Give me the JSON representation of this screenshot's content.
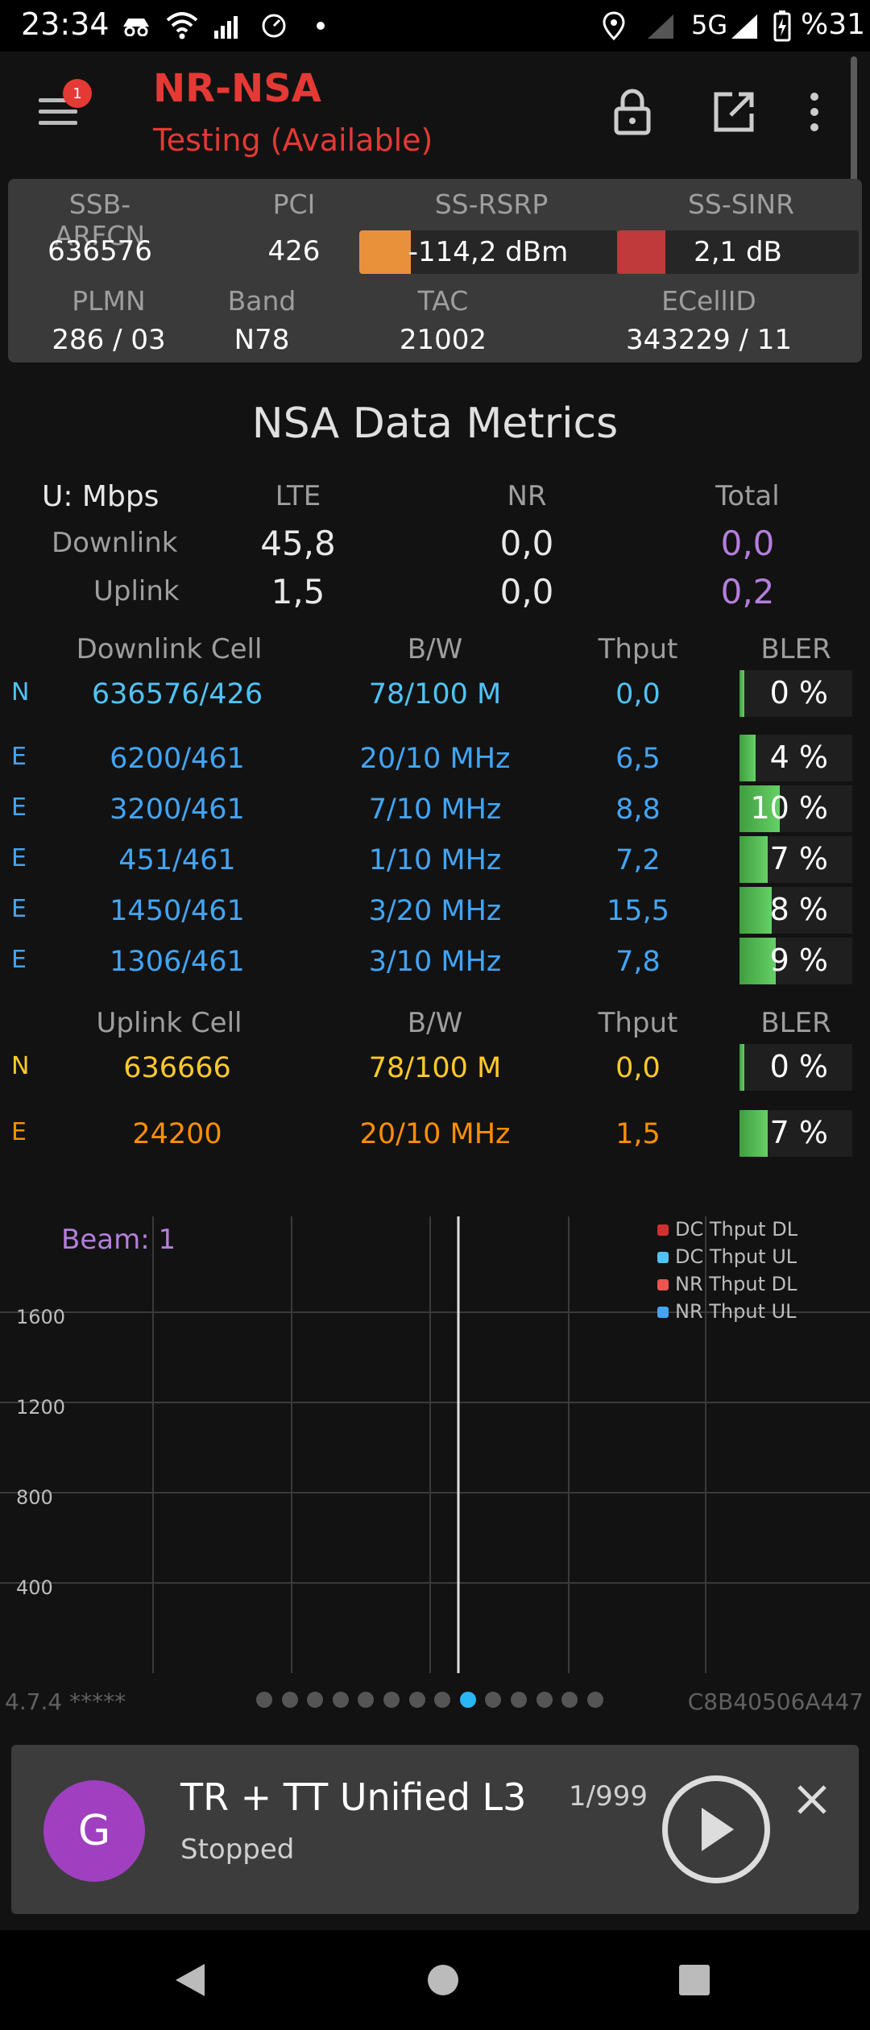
{
  "status_bar": {
    "time": "23:34",
    "network_type": "5G",
    "battery": "%31",
    "icons": [
      "incognito-icon",
      "wifi-icon",
      "signal-icon",
      "speedometer-icon",
      "dot-icon",
      "location-icon",
      "signal-icon",
      "battery-charging-icon"
    ]
  },
  "app_bar": {
    "title": "NR-NSA",
    "subtitle": "Testing (Available)",
    "notification_count": "1",
    "title_color": "#e53935"
  },
  "cell_info": {
    "labels": {
      "ssb_arfcn": "SSB-ARFCN",
      "pci": "PCI",
      "ss_rsrp": "SS-RSRP",
      "ss_sinr": "SS-SINR",
      "plmn": "PLMN",
      "band": "Band",
      "tac": "TAC",
      "ecellid": "ECellID"
    },
    "values": {
      "ssb_arfcn": "636576",
      "pci": "426",
      "ss_rsrp": "-114,2 dBm",
      "ss_sinr": "2,1 dB",
      "plmn": "286 / 03",
      "band": "N78",
      "tac": "21002",
      "ecellid": "343229 / 11"
    },
    "rsrp_level": 0.2,
    "sinr_level": 0.2,
    "rsrp_color": "#e8913a",
    "sinr_color": "#c0393b"
  },
  "metrics": {
    "title": "NSA Data Metrics",
    "unit_label": "U: Mbps",
    "col_lte": "LTE",
    "col_nr": "NR",
    "col_total": "Total",
    "downlink": {
      "label": "Downlink",
      "lte": "45,8",
      "nr": "0,0",
      "total": "0,0"
    },
    "uplink": {
      "label": "Uplink",
      "lte": "1,5",
      "nr": "0,0",
      "total": "0,2"
    }
  },
  "downlink_cells": {
    "header": {
      "cell": "Downlink Cell",
      "bw": "B/W",
      "thput": "Thput",
      "bler": "BLER"
    },
    "rows": [
      {
        "type": "N",
        "cell": "636576/426",
        "bw": "78/100 M",
        "thput": "0,0",
        "bler": "0 %",
        "bler_value": 0
      },
      {
        "type": "E",
        "cell": "6200/461",
        "bw": "20/10 MHz",
        "thput": "6,5",
        "bler": "4 %",
        "bler_value": 4
      },
      {
        "type": "E",
        "cell": "3200/461",
        "bw": "7/10 MHz",
        "thput": "8,8",
        "bler": "10 %",
        "bler_value": 10
      },
      {
        "type": "E",
        "cell": "451/461",
        "bw": "1/10 MHz",
        "thput": "7,2",
        "bler": "7 %",
        "bler_value": 7
      },
      {
        "type": "E",
        "cell": "1450/461",
        "bw": "3/20 MHz",
        "thput": "15,5",
        "bler": "8 %",
        "bler_value": 8
      },
      {
        "type": "E",
        "cell": "1306/461",
        "bw": "3/10 MHz",
        "thput": "7,8",
        "bler": "9 %",
        "bler_value": 9
      }
    ]
  },
  "uplink_cells": {
    "header": {
      "cell": "Uplink Cell",
      "bw": "B/W",
      "thput": "Thput",
      "bler": "BLER"
    },
    "rows": [
      {
        "type": "N",
        "cell": "636666",
        "bw": "78/100 M",
        "thput": "0,0",
        "bler": "0 %",
        "bler_value": 0
      },
      {
        "type": "E",
        "cell": "24200",
        "bw": "20/10 MHz",
        "thput": "1,5",
        "bler": "7 %",
        "bler_value": 7
      }
    ]
  },
  "chart_data": {
    "type": "line",
    "title": "Beam: 1",
    "xlabel": "",
    "ylabel": "",
    "y_ticks": [
      "400",
      "800",
      "1200",
      "1600"
    ],
    "ylim": [
      0,
      1900
    ],
    "grid": true,
    "legend_position": "top-right",
    "series": [
      {
        "name": "DC Thput DL",
        "color": "#d32f2f",
        "values": []
      },
      {
        "name": "DC Thput UL",
        "color": "#4fc3f7",
        "values": []
      },
      {
        "name": "NR Thput DL",
        "color": "#ef5350",
        "values": []
      },
      {
        "name": "NR Thput UL",
        "color": "#42a5f5",
        "values": []
      }
    ]
  },
  "footer": {
    "version": "4.7.4 *****",
    "device_id": "C8B40506A447",
    "page_count": 14,
    "active_page": 9
  },
  "player": {
    "avatar_letter": "G",
    "title": "TR + TT Unified L3",
    "status": "Stopped",
    "count": "1/999"
  }
}
